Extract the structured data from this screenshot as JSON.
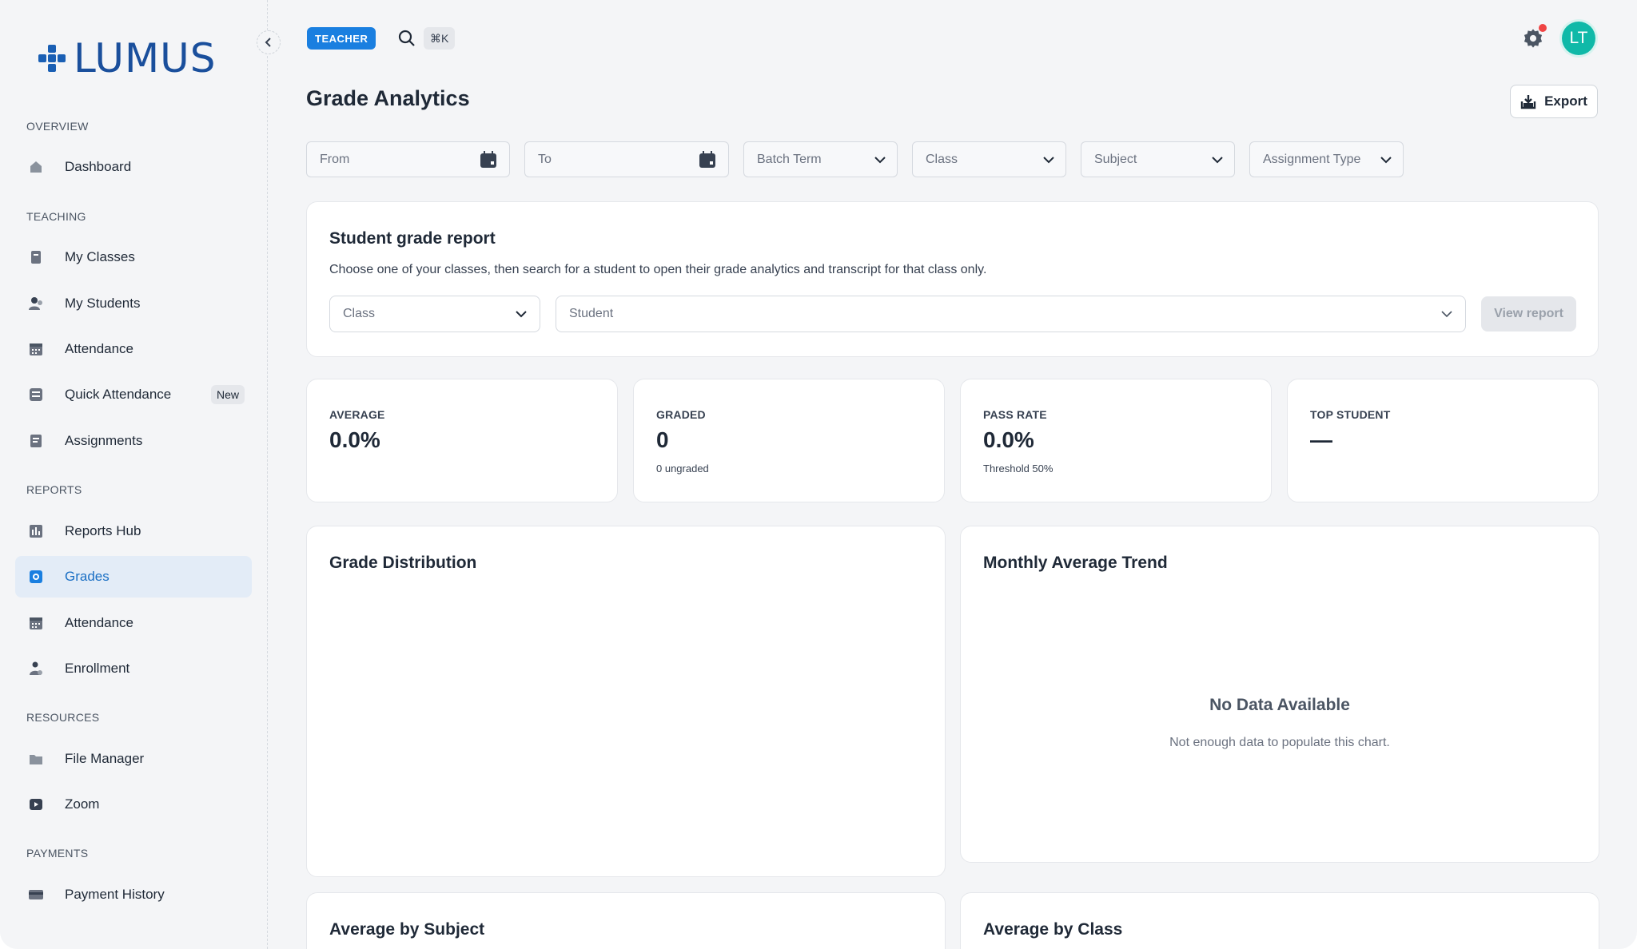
{
  "brand": {
    "name": "LUMUS",
    "color": "#1a4f9c"
  },
  "sidebar": {
    "sections": [
      {
        "title": "OVERVIEW",
        "items": [
          {
            "label": "Dashboard",
            "icon": "home-icon"
          }
        ]
      },
      {
        "title": "TEACHING",
        "items": [
          {
            "label": "My Classes",
            "icon": "book-icon"
          },
          {
            "label": "My Students",
            "icon": "users-icon"
          },
          {
            "label": "Attendance",
            "icon": "calendar-icon"
          },
          {
            "label": "Quick Attendance",
            "icon": "quick-attendance-icon",
            "badge": "New"
          },
          {
            "label": "Assignments",
            "icon": "assignment-icon"
          }
        ]
      },
      {
        "title": "REPORTS",
        "items": [
          {
            "label": "Reports Hub",
            "icon": "bar-chart-icon"
          },
          {
            "label": "Grades",
            "icon": "grades-icon",
            "active": true
          },
          {
            "label": "Attendance",
            "icon": "calendar-icon"
          },
          {
            "label": "Enrollment",
            "icon": "enrollment-icon"
          }
        ]
      },
      {
        "title": "RESOURCES",
        "items": [
          {
            "label": "File Manager",
            "icon": "folder-icon"
          },
          {
            "label": "Zoom",
            "icon": "video-icon"
          }
        ]
      },
      {
        "title": "PAYMENTS",
        "items": [
          {
            "label": "Payment History",
            "icon": "credit-card-icon"
          }
        ]
      }
    ]
  },
  "topbar": {
    "role": "TEACHER",
    "shortcut": "⌘K",
    "avatar_initials": "LT",
    "avatar_color": "#10b9a8",
    "accent": "#1a7fe0"
  },
  "page": {
    "title": "Grade Analytics",
    "export_label": "Export"
  },
  "filters": {
    "from": "From",
    "to": "To",
    "batch_term": "Batch Term",
    "class": "Class",
    "subject": "Subject",
    "assignment_type": "Assignment Type"
  },
  "report": {
    "title": "Student grade report",
    "description": "Choose one of your classes, then search for a student to open their grade analytics and transcript for that class only.",
    "class_placeholder": "Class",
    "student_placeholder": "Student",
    "view_label": "View report"
  },
  "stats": {
    "average": {
      "label": "AVERAGE",
      "value": "0.0%"
    },
    "graded": {
      "label": "GRADED",
      "value": "0",
      "sub": "0 ungraded"
    },
    "pass_rate": {
      "label": "PASS RATE",
      "value": "0.0%",
      "sub": "Threshold 50%"
    },
    "top_student": {
      "label": "TOP STUDENT",
      "value": "—"
    }
  },
  "charts": {
    "grade_distribution": {
      "title": "Grade Distribution"
    },
    "monthly_trend": {
      "title": "Monthly Average Trend",
      "empty_title": "No Data Available",
      "empty_sub": "Not enough data to populate this chart."
    },
    "by_subject": {
      "title": "Average by Subject"
    },
    "by_class": {
      "title": "Average by Class"
    }
  }
}
